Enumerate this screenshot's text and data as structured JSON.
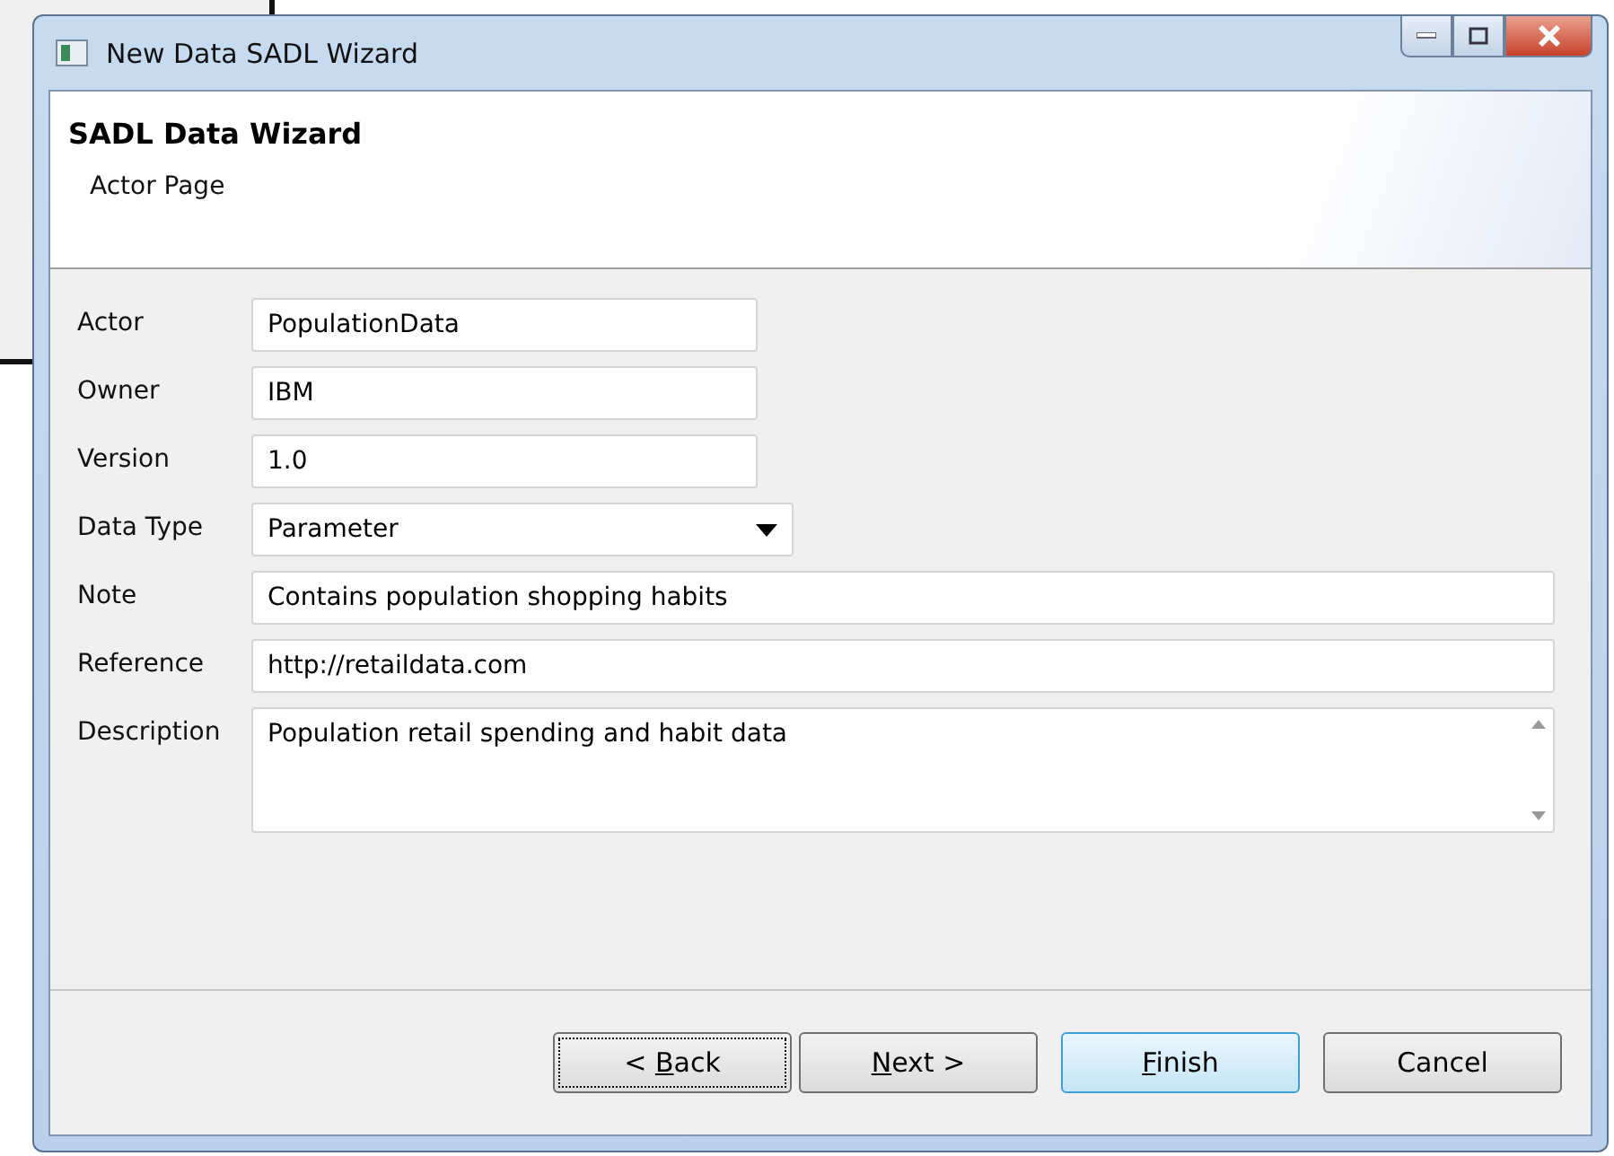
{
  "window": {
    "title": "New Data SADL Wizard"
  },
  "header": {
    "title": "SADL Data Wizard",
    "subtitle": "Actor Page"
  },
  "fields": [
    {
      "kind": "short_text",
      "label": "Actor",
      "value": "PopulationData"
    },
    {
      "kind": "short_text",
      "label": "Owner",
      "value": "IBM"
    },
    {
      "kind": "short_text",
      "label": "Version",
      "value": "1.0"
    },
    {
      "kind": "dropdown",
      "label": "Data Type",
      "value": "Parameter"
    },
    {
      "kind": "text",
      "label": "Note",
      "value": "Contains population shopping habits"
    },
    {
      "kind": "text",
      "label": "Reference",
      "value": "http://retaildata.com"
    },
    {
      "kind": "textarea",
      "label": "Description",
      "value": "Population retail spending and habit data"
    }
  ],
  "buttons": [
    {
      "prefix": "< ",
      "mnemonic": "B",
      "suffix": "ack",
      "focused": true,
      "default": false
    },
    {
      "mnemonic": "N",
      "suffix": "ext >",
      "focused": false,
      "default": false
    },
    {
      "mnemonic": "F",
      "suffix": "inish",
      "focused": false,
      "default": true
    },
    {
      "suffix": "Cancel",
      "focused": false,
      "default": false
    }
  ]
}
